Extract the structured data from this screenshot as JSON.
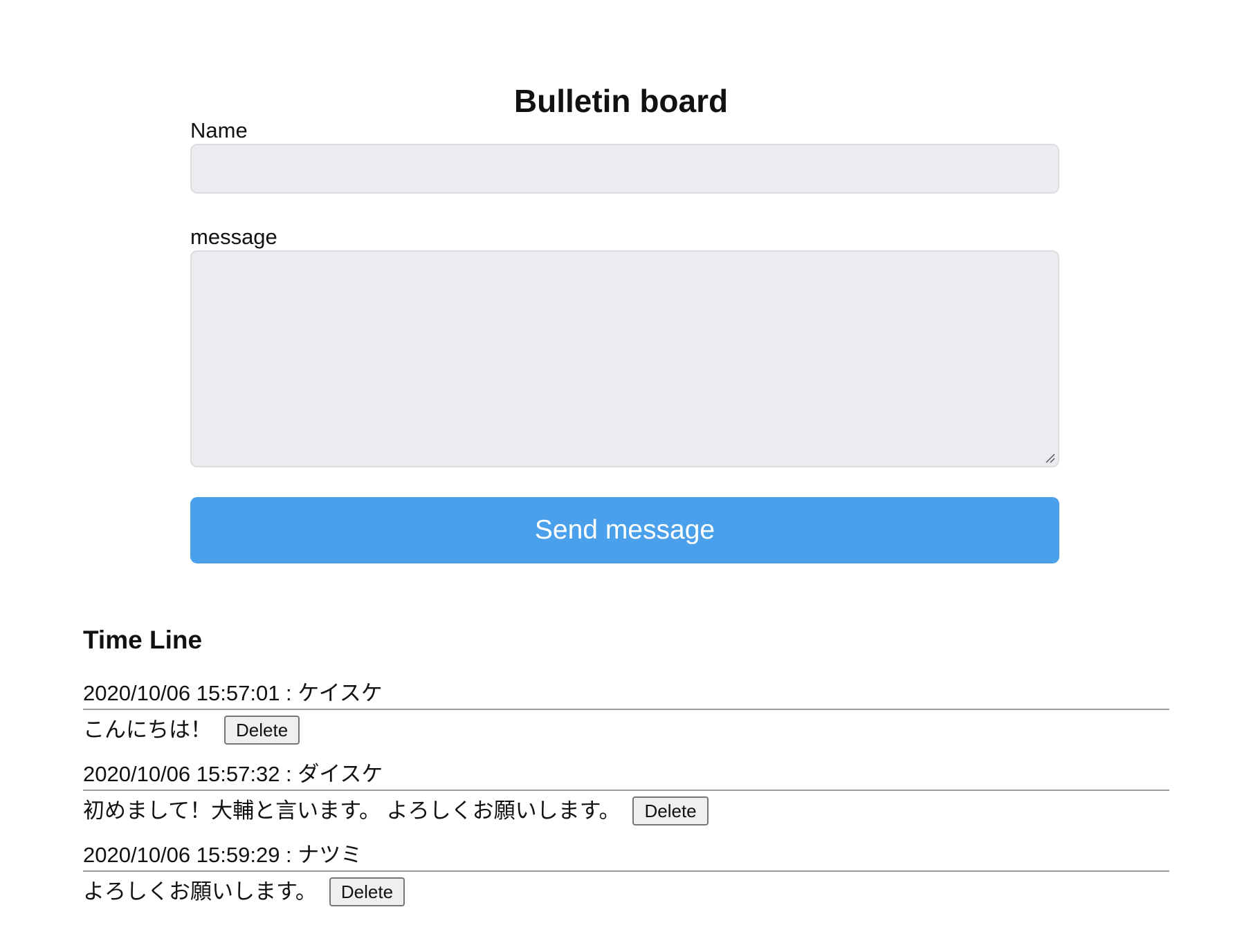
{
  "page": {
    "title": "Bulletin board"
  },
  "form": {
    "name_label": "Name",
    "name_value": "",
    "message_label": "message",
    "message_value": "",
    "send_label": "Send message"
  },
  "timeline": {
    "heading": "Time Line",
    "delete_label": "Delete",
    "posts": [
      {
        "header": "2020/10/06 15:57:01 : ケイスケ",
        "message": "こんにちは！"
      },
      {
        "header": "2020/10/06 15:57:32 : ダイスケ",
        "message": "初めまして！大輔と言います。 よろしくお願いします。"
      },
      {
        "header": "2020/10/06 15:59:29 : ナツミ",
        "message": "よろしくお願いします。"
      }
    ]
  },
  "colors": {
    "accent": "#4aa0ea",
    "input_background": "#ebecf0",
    "divider": "#9a9a9a"
  }
}
